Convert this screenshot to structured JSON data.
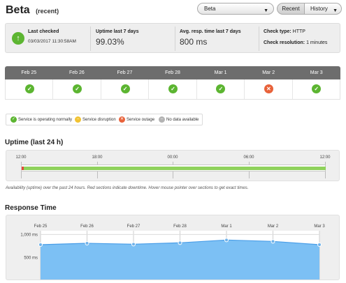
{
  "header": {
    "title": "Beta",
    "subtitle": "(recent)",
    "monitor_select": "Beta",
    "view_recent": "Recent",
    "view_history": "History"
  },
  "summary": {
    "last_checked_label": "Last checked",
    "last_checked_value": "03/03/2017 11:30:58AM",
    "uptime_label": "Uptime last 7 days",
    "uptime_value": "99.03%",
    "resp_label": "Avg. resp. time last 7 days",
    "resp_value": "800 ms",
    "check_type_label": "Check type:",
    "check_type_value": "HTTP",
    "check_res_label": "Check resolution:",
    "check_res_value": "1 minutes"
  },
  "days": [
    {
      "label": "Feb 25",
      "status": "ok"
    },
    {
      "label": "Feb 26",
      "status": "ok"
    },
    {
      "label": "Feb 27",
      "status": "ok"
    },
    {
      "label": "Feb 28",
      "status": "ok"
    },
    {
      "label": "Mar 1",
      "status": "ok"
    },
    {
      "label": "Mar 2",
      "status": "outage"
    },
    {
      "label": "Mar 3",
      "status": "ok"
    }
  ],
  "legend": {
    "normal": "Service is operating normally",
    "disruption": "Service disruption",
    "outage": "Service outage",
    "nodata": "No data available"
  },
  "uptime": {
    "title": "Uptime (last 24 h)",
    "ticks": [
      "12:00",
      "18:00",
      "00:00",
      "06:00",
      "12:00"
    ],
    "caption": "Availability (uptime) over the past 24 hours. Red sections indicate downtime. Hover mouse pointer over sections to get exact times."
  },
  "response": {
    "title": "Response Time"
  },
  "chart_data": {
    "type": "area",
    "title": "Response Time",
    "categories": [
      "Feb 25",
      "Feb 26",
      "Feb 27",
      "Feb 28",
      "Mar 1",
      "Mar 2",
      "Mar 3"
    ],
    "y_ticks": [
      "1,000 ms",
      "500 ms"
    ],
    "series": [
      {
        "values": [
          780,
          810,
          790,
          820,
          880,
          850,
          780
        ]
      }
    ],
    "ylim": [
      0,
      1500
    ],
    "grid": true,
    "color": "#7cc0f4"
  },
  "colors": {
    "ok": "#5cb531",
    "outage": "#e8623a",
    "disruption": "#f1c232",
    "nodata": "#b3b3b3",
    "header": "#6d6d6d"
  }
}
